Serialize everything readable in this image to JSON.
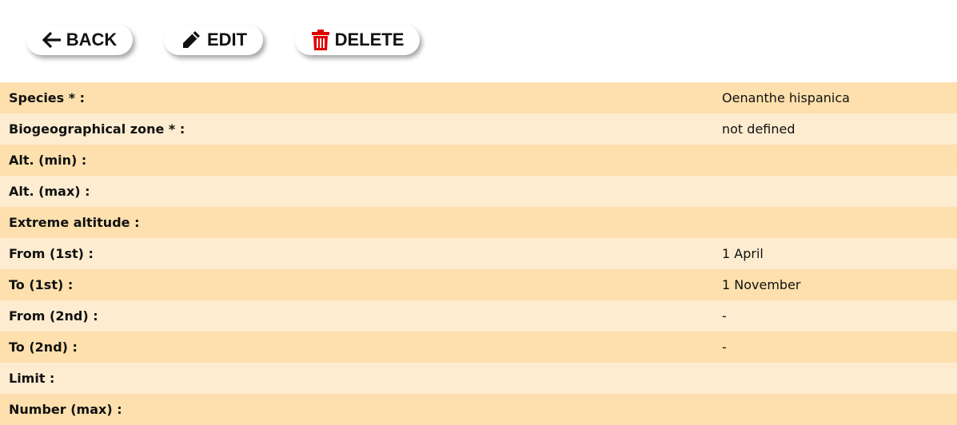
{
  "toolbar": {
    "back_label": "BACK",
    "edit_label": "EDIT",
    "delete_label": "DELETE",
    "back_icon": "arrow-left-icon",
    "edit_icon": "pencil-icon",
    "delete_icon": "trash-icon",
    "delete_icon_color": "#e00000"
  },
  "details": {
    "rows": [
      {
        "label": "Species * :",
        "value": "Oenanthe hispanica"
      },
      {
        "label": "Biogeographical zone * :",
        "value": "not defined"
      },
      {
        "label": "Alt. (min) :",
        "value": ""
      },
      {
        "label": "Alt. (max) :",
        "value": ""
      },
      {
        "label": "Extreme altitude :",
        "value": ""
      },
      {
        "label": "From (1st) :",
        "value": "1 April"
      },
      {
        "label": "To (1st) :",
        "value": "1 November"
      },
      {
        "label": "From (2nd) :",
        "value": "-"
      },
      {
        "label": "To (2nd) :",
        "value": "-"
      },
      {
        "label": "Limit :",
        "value": ""
      },
      {
        "label": "Number (max) :",
        "value": ""
      }
    ]
  },
  "colors": {
    "row_dark": "#fde0ad",
    "row_light": "#fdecd0"
  }
}
